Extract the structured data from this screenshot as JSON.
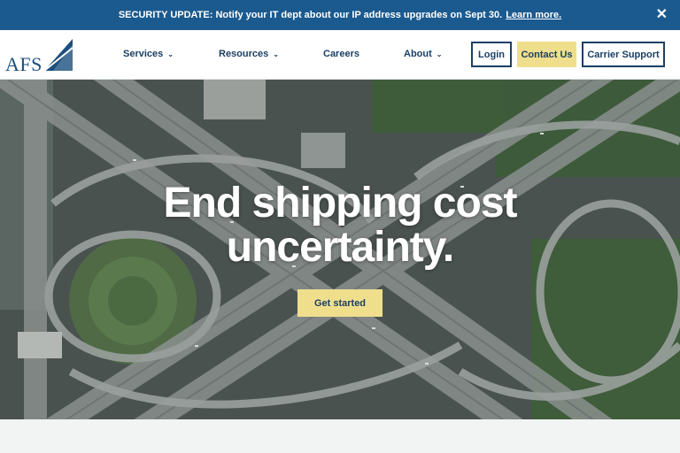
{
  "alert": {
    "message": "SECURITY UPDATE: Notify your IT dept about our IP address upgrades on Sept 30.",
    "link": "Learn more.",
    "close_icon": "close-icon"
  },
  "brand": {
    "logo_text": "AFS",
    "logo_icon": "afs-triangle-logo"
  },
  "nav": {
    "items": [
      {
        "label": "Services",
        "has_dropdown": true
      },
      {
        "label": "Resources",
        "has_dropdown": true
      },
      {
        "label": "Careers",
        "has_dropdown": false
      },
      {
        "label": "About",
        "has_dropdown": true
      }
    ],
    "login_label": "Login",
    "contact_label": "Contact Us",
    "carrier_label": "Carrier Support"
  },
  "hero": {
    "title_line1": "End shipping cost",
    "title_line2": "uncertainty.",
    "cta_label": "Get started"
  },
  "colors": {
    "alert_bg": "#1b5a8f",
    "brand_navy": "#1b3f63",
    "accent_yellow": "#efdf8d"
  }
}
